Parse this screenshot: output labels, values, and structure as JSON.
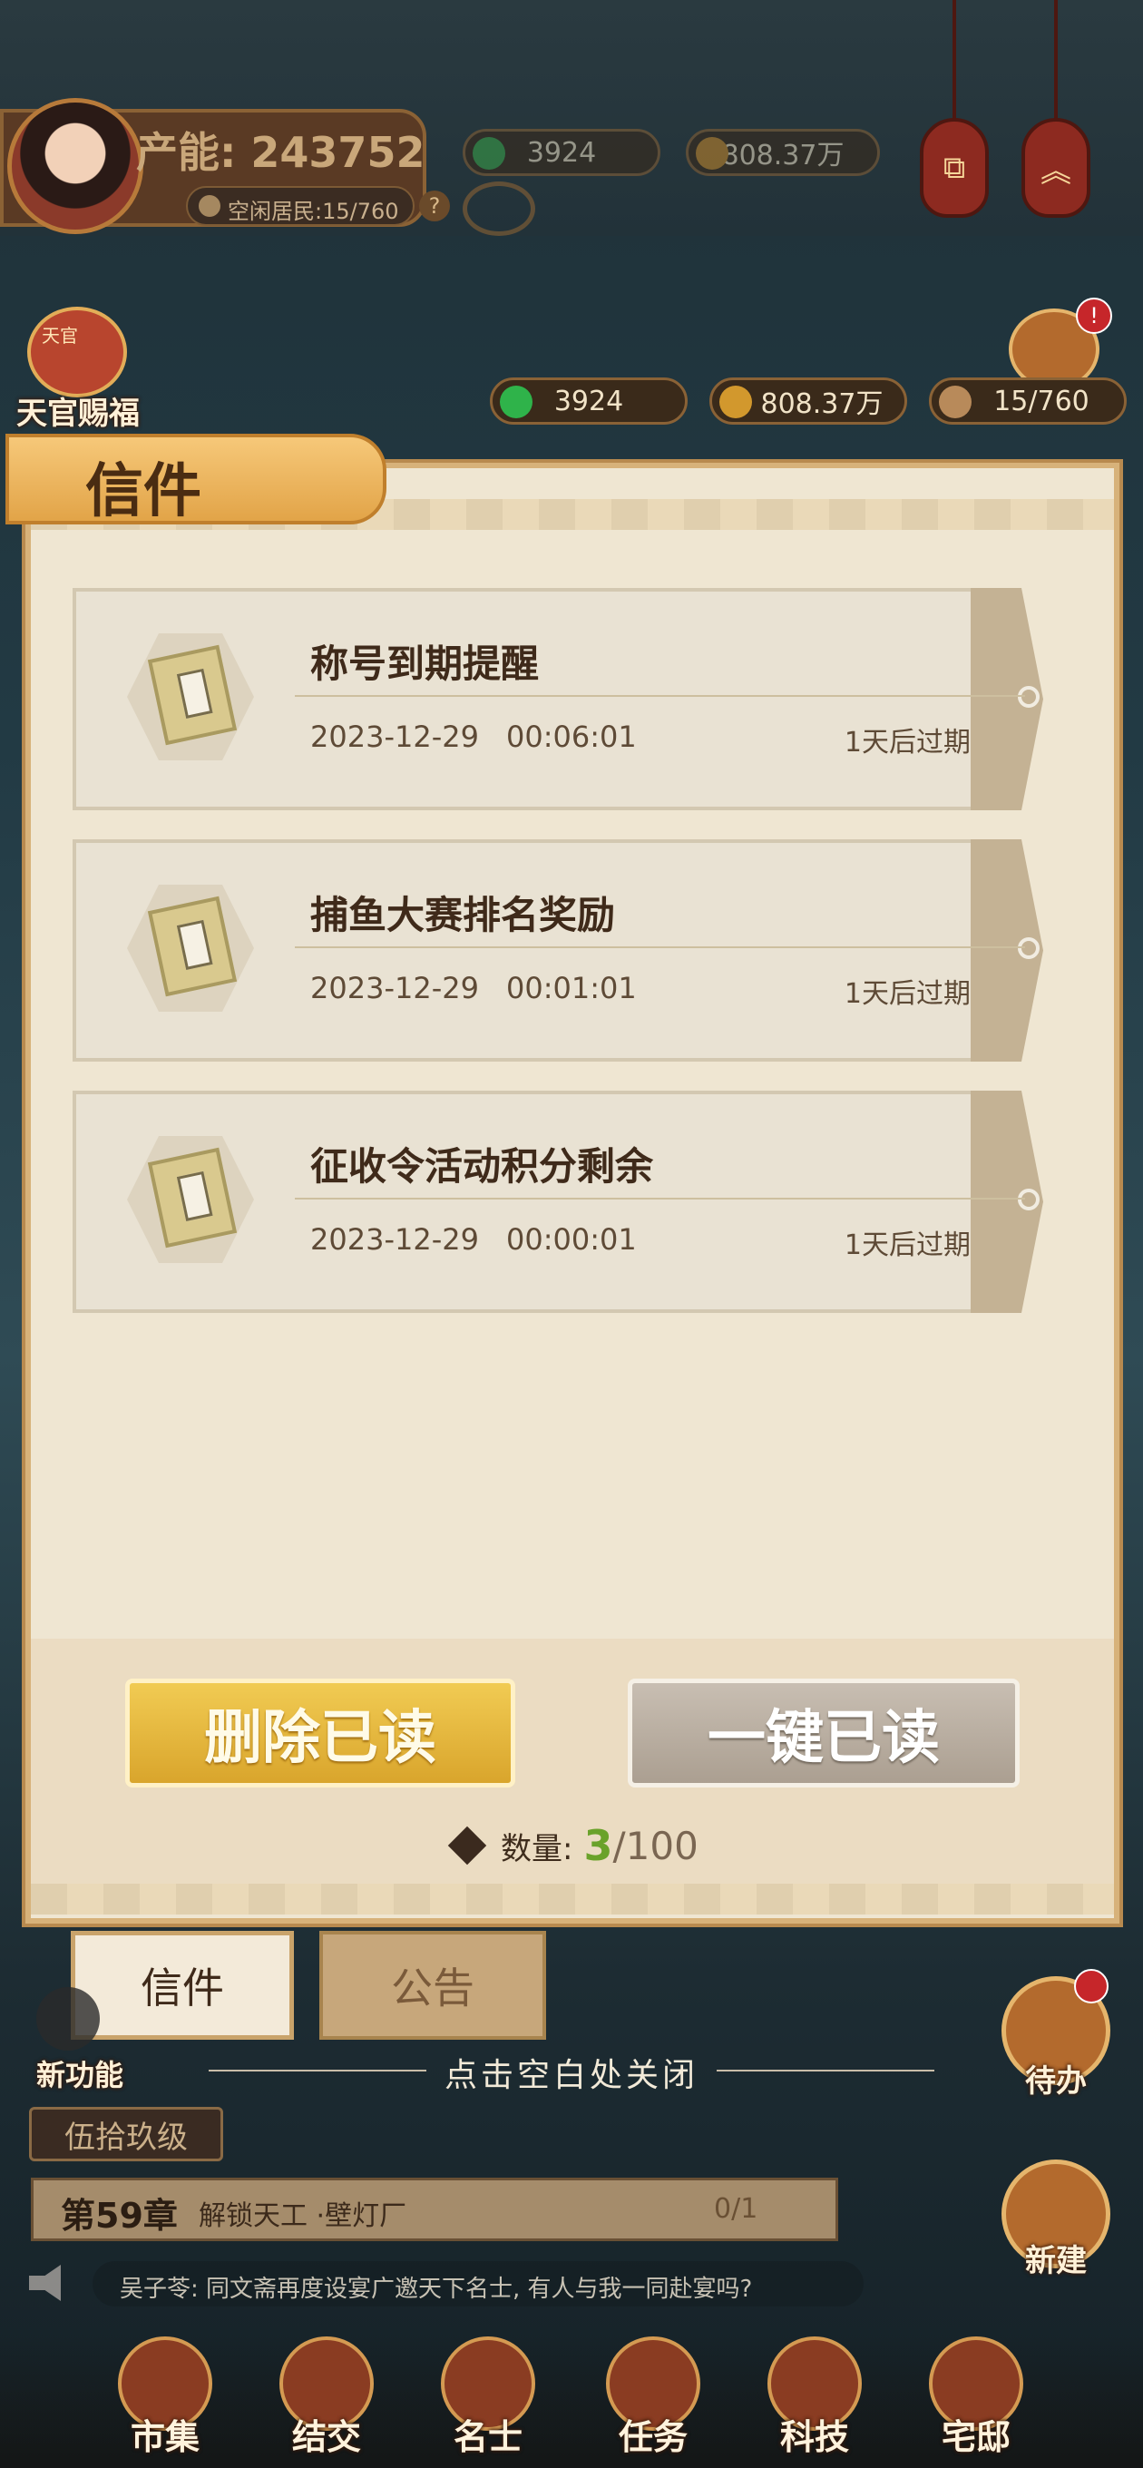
{
  "header": {
    "productivity_label": "产能: 243752",
    "idle_residents": "空闲居民:15/760",
    "coins_top": "3924",
    "copper_top": "808.37万"
  },
  "side_left": {
    "heaven_gift_label": "天官赐福",
    "heaven_gift_badge": "天官"
  },
  "resources": {
    "jade": "3924",
    "copper": "808.37万",
    "residents": "15/760"
  },
  "panel": {
    "title": "信件",
    "mails": [
      {
        "subject": "称号到期提醒",
        "date": "2023-12-29",
        "time": "00:06:01",
        "expiry": "1天后过期"
      },
      {
        "subject": "捕鱼大赛排名奖励",
        "date": "2023-12-29",
        "time": "00:01:01",
        "expiry": "1天后过期"
      },
      {
        "subject": "征收令活动积分剩余",
        "date": "2023-12-29",
        "time": "00:00:01",
        "expiry": "1天后过期"
      }
    ],
    "delete_read_label": "删除已读",
    "mark_all_read_label": "一键已读",
    "count_label": "数量:",
    "count_current": "3",
    "count_max": "/100",
    "tabs": {
      "mail": "信件",
      "announcement": "公告"
    }
  },
  "close_hint": "点击空白处关闭",
  "new_feature_label": "新功能",
  "todo_label": "待办",
  "build_label": "新建",
  "level": {
    "name": "伍拾玖级",
    "chapter": "第59章",
    "task": "解锁天工 ·壁灯厂",
    "progress": "0/1",
    "progress_fraction": 0
  },
  "chat": {
    "message": "吴子苓: 同文斋再度设宴广邀天下名士, 有人与我一同赴宴吗?"
  },
  "nav": [
    {
      "label": "市集"
    },
    {
      "label": "结交"
    },
    {
      "label": "名士"
    },
    {
      "label": "任务"
    },
    {
      "label": "科技"
    },
    {
      "label": "宅邸"
    }
  ],
  "colors": {
    "panel_bg": "#efe6d2",
    "gold_button": "#e6b83e",
    "gray_button": "#b8aea0",
    "count_accent": "#6aa22a"
  }
}
